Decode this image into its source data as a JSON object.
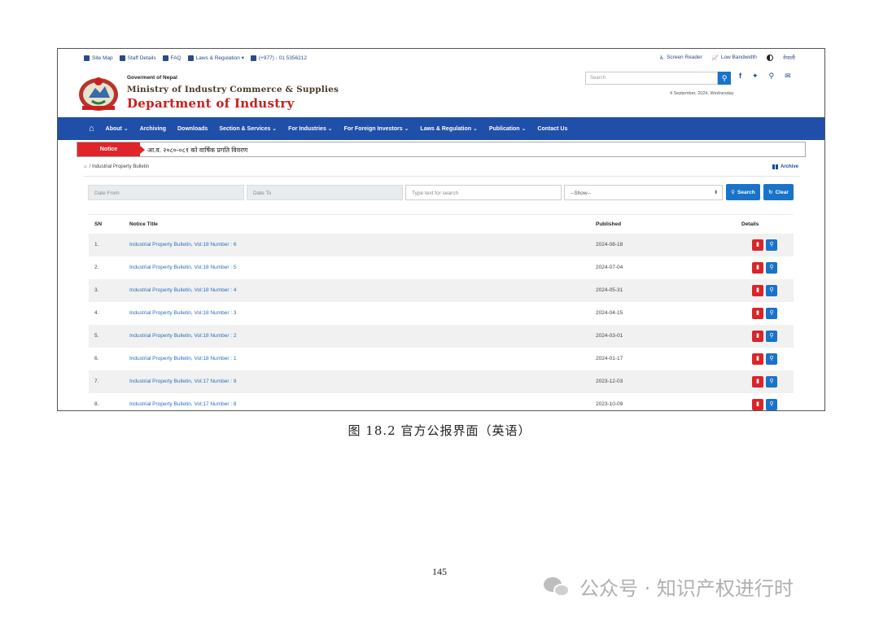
{
  "topbar": {
    "left": [
      {
        "icon": "sitemap-icon",
        "label": "Site Map"
      },
      {
        "icon": "staff-icon",
        "label": "Staff Details"
      },
      {
        "icon": "question-icon",
        "label": "FAQ"
      },
      {
        "icon": "balance-icon",
        "label": "Laws & Regulation ▾"
      },
      {
        "icon": "phone-icon",
        "label": "(+977) - 01 5356212"
      }
    ],
    "right": {
      "screen_reader": "Screen Reader",
      "low_bandwidth": "Low Bandwidth",
      "language": "नेपाली"
    }
  },
  "header": {
    "gov": "Goverment of Nepal",
    "ministry": "Ministry of Industry Commerce & Supplies",
    "department": "Department of Industry",
    "search_placeholder": "Search",
    "date": "4 September, 2024, Wednesday",
    "social_icons": [
      "facebook-icon",
      "twitter-icon",
      "location-icon",
      "mail-icon"
    ]
  },
  "nav": {
    "items": [
      "About ⌄",
      "Archiving",
      "Downloads",
      "Section & Services ⌄",
      "For Industries ⌄",
      "For Foreign Investors ⌄",
      "Laws & Regulation ⌄",
      "Publication ⌄",
      "Contact Us"
    ]
  },
  "notice": {
    "label": "Notice",
    "text": "आ.व. २०८०-०८१ को वार्षिक प्रगति विवरण"
  },
  "breadcrumb": {
    "text": "/ Industrial Property Bulletin",
    "archive": "Archive"
  },
  "filters": {
    "date_from": "Date From",
    "date_to": "Date To",
    "search_placeholder": "Type text for search",
    "show_select": "--Show--",
    "search_button": "Search",
    "clear_button": "Clear"
  },
  "table": {
    "headers": {
      "sn": "SN",
      "title": "Notice Title",
      "published": "Published",
      "details": "Details"
    },
    "rows": [
      {
        "sn": "1.",
        "title": "Industrial Property Bulletin, Vol:18 Number : 6",
        "published": "2024-08-18"
      },
      {
        "sn": "2.",
        "title": "Industrial Property Bulletin, Vol:18 Number : 5",
        "published": "2024-07-04"
      },
      {
        "sn": "3.",
        "title": "Industrial Property Bulletin, Vol:18 Number : 4",
        "published": "2024-05-31"
      },
      {
        "sn": "4.",
        "title": "Industrial Property Bulletin, Vol:18 Number : 3",
        "published": "2024-04-15"
      },
      {
        "sn": "5.",
        "title": "Industrial Property Bulletin, Vol:18 Number : 2",
        "published": "2024-03-01"
      },
      {
        "sn": "6.",
        "title": "Industrial Property Bulletin, Vol:18 Number : 1",
        "published": "2024-01-17"
      },
      {
        "sn": "7.",
        "title": "Industrial Property Bulletin, Vol:17 Number : 9",
        "published": "2023-12-03"
      },
      {
        "sn": "8.",
        "title": "Industrial Property Bulletin, Vol:17 Number : 8",
        "published": "2023-10-09"
      }
    ]
  },
  "caption": "图 18.2  官方公报界面（英语）",
  "page_number": "145",
  "watermark": "公众号 · 知识产权进行时",
  "colors": {
    "nav": "#1f4fa8",
    "notice": "#e0242a",
    "link": "#2a6fc0",
    "dept_title": "#c8201e"
  }
}
